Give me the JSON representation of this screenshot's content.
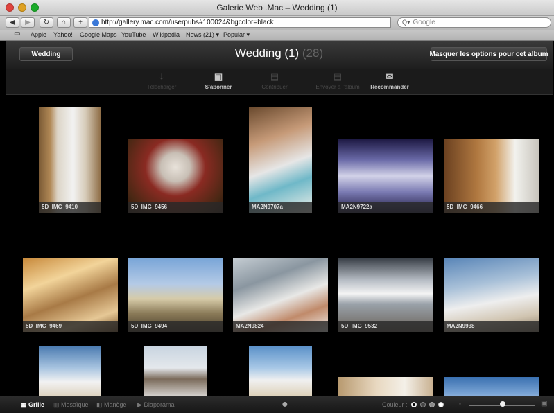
{
  "window": {
    "title": "Galerie Web .Mac – Wedding (1)"
  },
  "toolbar": {
    "url": "http://gallery.mac.com/userpubs#100024&bgcolor=black",
    "search_placeholder": "Google",
    "back_icon": "back-arrow-icon",
    "forward_icon": "forward-arrow-icon",
    "reload_icon": "reload-icon",
    "home_icon": "home-icon",
    "add_icon": "plus-icon"
  },
  "bookmarks": [
    "Apple",
    "Yahoo!",
    "Google Maps",
    "YouTube",
    "Wikipedia",
    "News (21) ▾",
    "Popular ▾"
  ],
  "gallery": {
    "back_button": "Wedding",
    "title": "Wedding (1)",
    "count": "(28)",
    "options_button": "Masquer les options pour cet album"
  },
  "actions": [
    {
      "label": "Télécharger",
      "icon": "download-icon",
      "enabled": false
    },
    {
      "label": "S'abonner",
      "icon": "rss-subscribe-icon",
      "enabled": true
    },
    {
      "label": "Contribuer",
      "icon": "contribute-icon",
      "enabled": false
    },
    {
      "label": "Envoyer à l'album",
      "icon": "send-to-album-icon",
      "enabled": false
    },
    {
      "label": "Recommander",
      "icon": "envelope-icon",
      "enabled": true
    }
  ],
  "photos": [
    {
      "name": "5D_IMG_9410"
    },
    {
      "name": "5D_IMG_9456"
    },
    {
      "name": "MA2N9707a"
    },
    {
      "name": "MA2N9722a"
    },
    {
      "name": "5D_IMG_9466"
    },
    {
      "name": "5D_IMG_9469"
    },
    {
      "name": "5D_IMG_9494"
    },
    {
      "name": "MA2N9824"
    },
    {
      "name": "5D_IMG_9532"
    },
    {
      "name": "MA2N9938"
    },
    {
      "name": ""
    },
    {
      "name": ""
    },
    {
      "name": ""
    },
    {
      "name": ""
    },
    {
      "name": ""
    }
  ],
  "bottombar": {
    "views": [
      {
        "label": "Grille",
        "icon": "grid-icon",
        "active": true
      },
      {
        "label": "Mosaïque",
        "icon": "mosaic-icon",
        "active": false
      },
      {
        "label": "Manège",
        "icon": "carousel-icon",
        "active": false
      },
      {
        "label": "Diaporama",
        "icon": "slideshow-icon",
        "active": false
      }
    ],
    "logo_icon": "apple-logo-icon",
    "color_label": "Couleur :",
    "colors": [
      "#000000",
      "#444444",
      "#888888",
      "#ffffff"
    ],
    "thumbnail_size_level": 0.47
  }
}
